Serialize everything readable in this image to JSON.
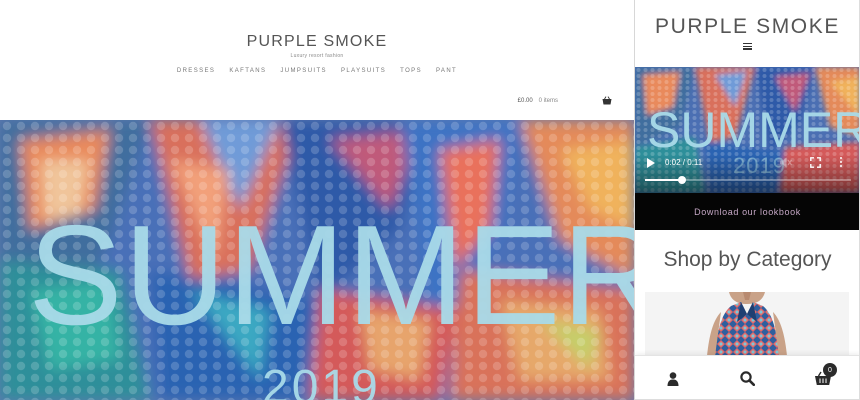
{
  "desktop": {
    "logo": "PURPLE SMOKE",
    "tagline": "Luxury resort fashion",
    "nav": [
      "DRESSES",
      "KAFTANS",
      "JUMPSUITS",
      "PLAYSUITS",
      "TOPS",
      "PANT"
    ],
    "cart": {
      "amount": "£0.00",
      "count": "0 items",
      "icon": "basket-icon"
    },
    "hero": {
      "title": "SUMMER",
      "year": "2019"
    }
  },
  "mobile": {
    "logo": "PURPLE SMOKE",
    "menu_icon": "hamburger-menu-icon",
    "video": {
      "title": "SUMMER",
      "year": "2019",
      "time": "0:02 / 0:11",
      "progress": 0.18
    },
    "download_label": "Download our lookbook",
    "category_title": "Shop by Category",
    "bottom_bar": {
      "icons": [
        "account-icon",
        "search-icon",
        "cart-icon"
      ],
      "cart_count": "0"
    }
  },
  "colors": {
    "hero_text": "#a9dbe9",
    "download_text": "#c5a7c5",
    "download_bg": "#050505"
  }
}
